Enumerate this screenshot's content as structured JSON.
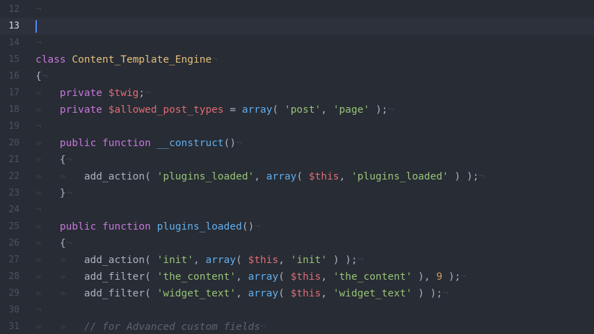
{
  "editor": {
    "lines": [
      {
        "num": "12",
        "tokens": [
          {
            "t": "¬",
            "c": "inv"
          }
        ]
      },
      {
        "num": "13",
        "active": true,
        "tokens": []
      },
      {
        "num": "14",
        "tokens": [
          {
            "t": "¬",
            "c": "inv"
          }
        ]
      },
      {
        "num": "15",
        "tokens": [
          {
            "t": "class",
            "c": "kw"
          },
          {
            "t": " ",
            "c": "pl"
          },
          {
            "t": "Content_Template_Engine",
            "c": "cls"
          },
          {
            "t": "¬",
            "c": "inv"
          }
        ]
      },
      {
        "num": "16",
        "tokens": [
          {
            "t": "{",
            "c": "pl"
          },
          {
            "t": "¬",
            "c": "inv"
          }
        ]
      },
      {
        "num": "17",
        "tokens": [
          {
            "t": "»   ",
            "c": "inv"
          },
          {
            "t": "private",
            "c": "kw"
          },
          {
            "t": " ",
            "c": "pl"
          },
          {
            "t": "$twig",
            "c": "var"
          },
          {
            "t": ";",
            "c": "pl"
          },
          {
            "t": "¬",
            "c": "inv"
          }
        ]
      },
      {
        "num": "18",
        "tokens": [
          {
            "t": "»   ",
            "c": "inv"
          },
          {
            "t": "private",
            "c": "kw"
          },
          {
            "t": " ",
            "c": "pl"
          },
          {
            "t": "$allowed_post_types",
            "c": "var"
          },
          {
            "t": " = ",
            "c": "pl"
          },
          {
            "t": "array",
            "c": "fn"
          },
          {
            "t": "( ",
            "c": "pl"
          },
          {
            "t": "'post'",
            "c": "str"
          },
          {
            "t": ", ",
            "c": "pl"
          },
          {
            "t": "'page'",
            "c": "str"
          },
          {
            "t": " );",
            "c": "pl"
          },
          {
            "t": "¬",
            "c": "inv"
          }
        ]
      },
      {
        "num": "19",
        "tokens": [
          {
            "t": "¬",
            "c": "inv"
          }
        ]
      },
      {
        "num": "20",
        "tokens": [
          {
            "t": "»   ",
            "c": "inv"
          },
          {
            "t": "public",
            "c": "kw"
          },
          {
            "t": " ",
            "c": "pl"
          },
          {
            "t": "function",
            "c": "kw"
          },
          {
            "t": " ",
            "c": "pl"
          },
          {
            "t": "__construct",
            "c": "fn"
          },
          {
            "t": "()",
            "c": "pl"
          },
          {
            "t": "¬",
            "c": "inv"
          }
        ]
      },
      {
        "num": "21",
        "tokens": [
          {
            "t": "»   ",
            "c": "inv"
          },
          {
            "t": "{",
            "c": "pl"
          },
          {
            "t": "¬",
            "c": "inv"
          }
        ]
      },
      {
        "num": "22",
        "tokens": [
          {
            "t": "»   »   ",
            "c": "inv"
          },
          {
            "t": "add_action( ",
            "c": "pl"
          },
          {
            "t": "'plugins_loaded'",
            "c": "str"
          },
          {
            "t": ", ",
            "c": "pl"
          },
          {
            "t": "array",
            "c": "fn"
          },
          {
            "t": "( ",
            "c": "pl"
          },
          {
            "t": "$this",
            "c": "var"
          },
          {
            "t": ", ",
            "c": "pl"
          },
          {
            "t": "'plugins_loaded'",
            "c": "str"
          },
          {
            "t": " ) );",
            "c": "pl"
          },
          {
            "t": "¬",
            "c": "inv"
          }
        ]
      },
      {
        "num": "23",
        "tokens": [
          {
            "t": "»   ",
            "c": "inv"
          },
          {
            "t": "}",
            "c": "pl"
          },
          {
            "t": "¬",
            "c": "inv"
          }
        ]
      },
      {
        "num": "24",
        "tokens": [
          {
            "t": "¬",
            "c": "inv"
          }
        ]
      },
      {
        "num": "25",
        "tokens": [
          {
            "t": "»   ",
            "c": "inv"
          },
          {
            "t": "public",
            "c": "kw"
          },
          {
            "t": " ",
            "c": "pl"
          },
          {
            "t": "function",
            "c": "kw"
          },
          {
            "t": " ",
            "c": "pl"
          },
          {
            "t": "plugins_loaded",
            "c": "fn"
          },
          {
            "t": "()",
            "c": "pl"
          },
          {
            "t": "¬",
            "c": "inv"
          }
        ]
      },
      {
        "num": "26",
        "tokens": [
          {
            "t": "»   ",
            "c": "inv"
          },
          {
            "t": "{",
            "c": "pl"
          },
          {
            "t": "¬",
            "c": "inv"
          }
        ]
      },
      {
        "num": "27",
        "tokens": [
          {
            "t": "»   »   ",
            "c": "inv"
          },
          {
            "t": "add_action( ",
            "c": "pl"
          },
          {
            "t": "'init'",
            "c": "str"
          },
          {
            "t": ", ",
            "c": "pl"
          },
          {
            "t": "array",
            "c": "fn"
          },
          {
            "t": "( ",
            "c": "pl"
          },
          {
            "t": "$this",
            "c": "var"
          },
          {
            "t": ", ",
            "c": "pl"
          },
          {
            "t": "'init'",
            "c": "str"
          },
          {
            "t": " ) );",
            "c": "pl"
          },
          {
            "t": "¬",
            "c": "inv"
          }
        ]
      },
      {
        "num": "28",
        "tokens": [
          {
            "t": "»   »   ",
            "c": "inv"
          },
          {
            "t": "add_filter( ",
            "c": "pl"
          },
          {
            "t": "'the_content'",
            "c": "str"
          },
          {
            "t": ", ",
            "c": "pl"
          },
          {
            "t": "array",
            "c": "fn"
          },
          {
            "t": "( ",
            "c": "pl"
          },
          {
            "t": "$this",
            "c": "var"
          },
          {
            "t": ", ",
            "c": "pl"
          },
          {
            "t": "'the_content'",
            "c": "str"
          },
          {
            "t": " ), ",
            "c": "pl"
          },
          {
            "t": "9",
            "c": "num"
          },
          {
            "t": " );",
            "c": "pl"
          },
          {
            "t": "¬",
            "c": "inv"
          }
        ]
      },
      {
        "num": "29",
        "tokens": [
          {
            "t": "»   »   ",
            "c": "inv"
          },
          {
            "t": "add_filter( ",
            "c": "pl"
          },
          {
            "t": "'widget_text'",
            "c": "str"
          },
          {
            "t": ", ",
            "c": "pl"
          },
          {
            "t": "array",
            "c": "fn"
          },
          {
            "t": "( ",
            "c": "pl"
          },
          {
            "t": "$this",
            "c": "var"
          },
          {
            "t": ", ",
            "c": "pl"
          },
          {
            "t": "'widget_text'",
            "c": "str"
          },
          {
            "t": " ) );",
            "c": "pl"
          },
          {
            "t": "¬",
            "c": "inv"
          }
        ]
      },
      {
        "num": "30",
        "tokens": [
          {
            "t": "¬",
            "c": "inv"
          }
        ]
      },
      {
        "num": "31",
        "tokens": [
          {
            "t": "»   »   ",
            "c": "inv"
          },
          {
            "t": "// for Advanced custom fields",
            "c": "cm"
          },
          {
            "t": "¬",
            "c": "inv"
          }
        ]
      }
    ]
  }
}
